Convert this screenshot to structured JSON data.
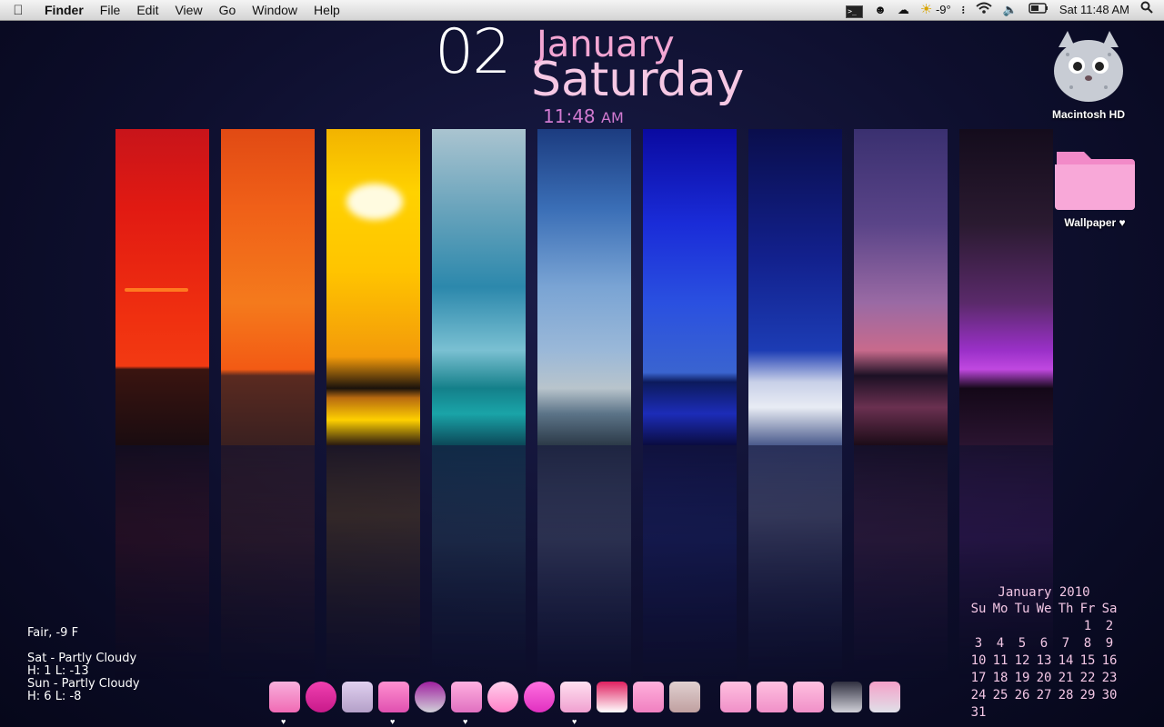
{
  "menubar": {
    "app_name": "Finder",
    "menus": [
      "File",
      "Edit",
      "View",
      "Go",
      "Window",
      "Help"
    ],
    "weather_temp": "-9°",
    "clock": "Sat 11:48 AM"
  },
  "clock_widget": {
    "day": "02",
    "month": "January",
    "weekday": "Saturday",
    "time": "11:48",
    "ampm": "AM"
  },
  "desktop": {
    "icons": [
      {
        "label": "Macintosh HD",
        "icon": "hard-drive-cat-icon"
      },
      {
        "label": "Wallpaper ♥",
        "icon": "pink-folder-icon"
      }
    ]
  },
  "weather": {
    "current": "Fair, -9 F",
    "forecast": [
      {
        "day": "Sat - Partly Cloudy",
        "hl": "H: 1 L: -13"
      },
      {
        "day": "Sun - Partly Cloudy",
        "hl": "H: 6 L: -8"
      }
    ]
  },
  "calendar": {
    "title": "January 2010",
    "weekdays": [
      "Su",
      "Mo",
      "Tu",
      "We",
      "Th",
      "Fr",
      "Sa"
    ],
    "days": [
      "",
      "",
      "",
      "",
      "",
      "1",
      "2",
      "3",
      "4",
      "5",
      "6",
      "7",
      "8",
      "9",
      "10",
      "11",
      "12",
      "13",
      "14",
      "15",
      "16",
      "17",
      "18",
      "19",
      "20",
      "21",
      "22",
      "23",
      "24",
      "25",
      "26",
      "27",
      "28",
      "29",
      "30",
      "31",
      "",
      "",
      "",
      "",
      "",
      ""
    ]
  },
  "dock": {
    "items": [
      "finder-icon",
      "dashboard-icon",
      "mission-control-icon",
      "preview-icon",
      "safari-icon",
      "adium-icon",
      "skype-icon",
      "ichat-icon",
      "itunes-icon",
      "ical-icon",
      "address-book-icon",
      "iphoto-icon",
      "applications-folder-icon",
      "documents-folder-icon",
      "downloads-folder-icon",
      "screenshot-icon",
      "trash-icon"
    ],
    "running_glyph": "♥"
  },
  "colors": {
    "accent_pink": "#f3a6d3",
    "background": "#0e0f2e"
  }
}
